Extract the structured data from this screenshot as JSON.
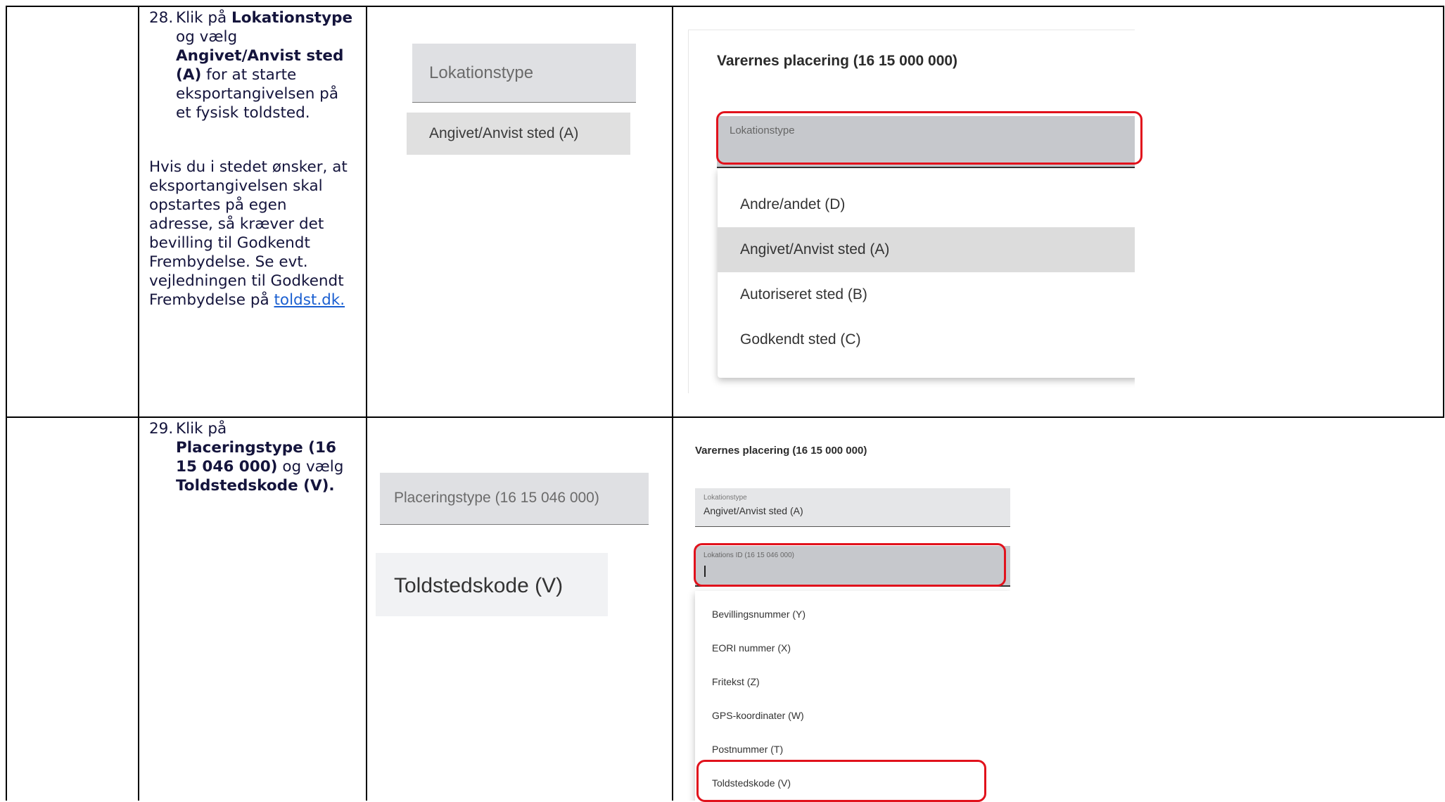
{
  "rows": [
    {
      "step_number": "28.",
      "instruction": {
        "t1": "Klik på ",
        "b1": "Lokationstype",
        "t2": " og vælg ",
        "b2": "Angivet/Anvist sted (A)",
        "t3": " for at starte eksportangivelsen på et fysisk toldsted."
      },
      "note": "Hvis du i stedet ønsker, at eksportangivelsen skal opstartes på egen adresse, så kræver det bevilling til Godkendt Frembydelse. Se evt. vejledningen til Godkendt Frembydelse på ",
      "link_text": "toldst.dk.",
      "snippet_field_label": "Lokationstype",
      "snippet_option": "Angivet/Anvist sted (A)",
      "screenshot": {
        "section_title": "Varernes placering (16 15 000 000)",
        "field_label": "Lokationstype",
        "options": [
          "Andre/andet (D)",
          "Angivet/Anvist sted (A)",
          "Autoriseret sted (B)",
          "Godkendt sted (C)"
        ],
        "selected_index": 1
      }
    },
    {
      "step_number": "29.",
      "instruction": {
        "t1": "Klik på ",
        "b1": "Placeringstype (16 15 046 000)",
        "t2": " og vælg ",
        "b2": "Toldstedskode (V)."
      },
      "snippet_field_label": "Placeringstype (16 15 046 000)",
      "snippet_option": "Toldstedskode (V)",
      "screenshot": {
        "section_title": "Varernes placering (16 15 000 000)",
        "field1_label": "Lokationstype",
        "field1_value": "Angivet/Anvist sted (A)",
        "field2_label": "Lokations ID (16 15 046 000)",
        "options": [
          "Bevillingsnummer (Y)",
          "EORI nummer (X)",
          "Fritekst (Z)",
          "GPS-koordinater (W)",
          "Postnummer (T)",
          "Toldstedskode (V)"
        ],
        "highlighted_index": 5
      }
    }
  ]
}
